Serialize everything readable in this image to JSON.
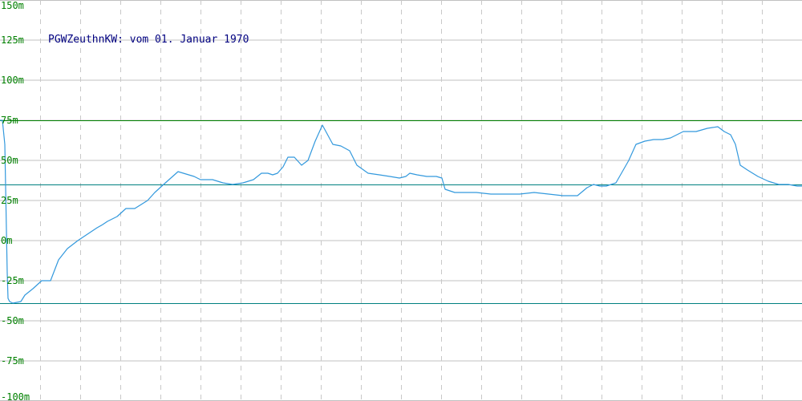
{
  "chart_data": {
    "type": "line",
    "title": "PGWZeuthnKW: vom 01. Januar 1970",
    "xlabel": "",
    "ylabel": "",
    "ylim": [
      -100,
      150
    ],
    "y_ticks": [
      150,
      125,
      100,
      75,
      50,
      25,
      0,
      -25,
      -50,
      -75,
      -100
    ],
    "y_tick_labels": [
      "150m",
      "125m",
      "100m",
      "75m",
      "50m",
      "25m",
      "0m",
      "-25m",
      "-50m",
      "-75m",
      "-100m"
    ],
    "grid": true,
    "reference_lines": [
      {
        "value": 75,
        "color": "#008000"
      },
      {
        "value": 35,
        "color": "#008080"
      },
      {
        "value": -39,
        "color": "#008080"
      }
    ],
    "series": [
      {
        "color": "#3399dd",
        "x": [
          0.0,
          0.3,
          0.6,
          0.9,
          1.0,
          1.2,
          1.6,
          2.6,
          3.1,
          4.1,
          5.2,
          6.3,
          7.3,
          8.4,
          9.7,
          12.1,
          12.8,
          13.4,
          14.6,
          15.7,
          16.8,
          18.4,
          19.3,
          20.4,
          22.2,
          24.2,
          25.0,
          26.5,
          27.8,
          29.0,
          30.3,
          31.6,
          32.1,
          32.6,
          33.4,
          34.0,
          34.6,
          35.3,
          35.9,
          36.7,
          37.6,
          38.4,
          39.3,
          40.2,
          41.5,
          42.5,
          43.6,
          44.5,
          45.9,
          47.3,
          48.6,
          49.8,
          50.6,
          51.1,
          52.0,
          53.2,
          54.4,
          55.1,
          55.5,
          56.7,
          58.0,
          59.4,
          61.2,
          63.0,
          64.8,
          66.6,
          68.4,
          70.2,
          72.0,
          73.2,
          74.0,
          74.8,
          75.6,
          76.8,
          78.4,
          79.3,
          80.4,
          81.5,
          82.6,
          83.6,
          85.2,
          86.8,
          88.2,
          89.5,
          90.3,
          91.1,
          91.7,
          92.3,
          93.2,
          94.5,
          95.8,
          97.1,
          98.3,
          99.4,
          100.0
        ],
        "y": [
          75,
          75,
          60,
          -20,
          -36,
          -38,
          -39,
          -38,
          -34,
          -30,
          -25,
          -25,
          -12,
          -5,
          0,
          8,
          10,
          12,
          15,
          20,
          20,
          25,
          30,
          35,
          43,
          40,
          38,
          38,
          36,
          35,
          36,
          38,
          40,
          42,
          42,
          41,
          42,
          46,
          52,
          52,
          47,
          50,
          62,
          72,
          60,
          59,
          56,
          47,
          42,
          41,
          40,
          39,
          40,
          42,
          41,
          40,
          40,
          39,
          32,
          30,
          30,
          30,
          29,
          29,
          29,
          30,
          29,
          28,
          28,
          33,
          35,
          34,
          34,
          36,
          50,
          60,
          62,
          63,
          63,
          64,
          68,
          68,
          70,
          71,
          68,
          66,
          60,
          47,
          44,
          40,
          37,
          35,
          35,
          34,
          34
        ]
      }
    ]
  }
}
